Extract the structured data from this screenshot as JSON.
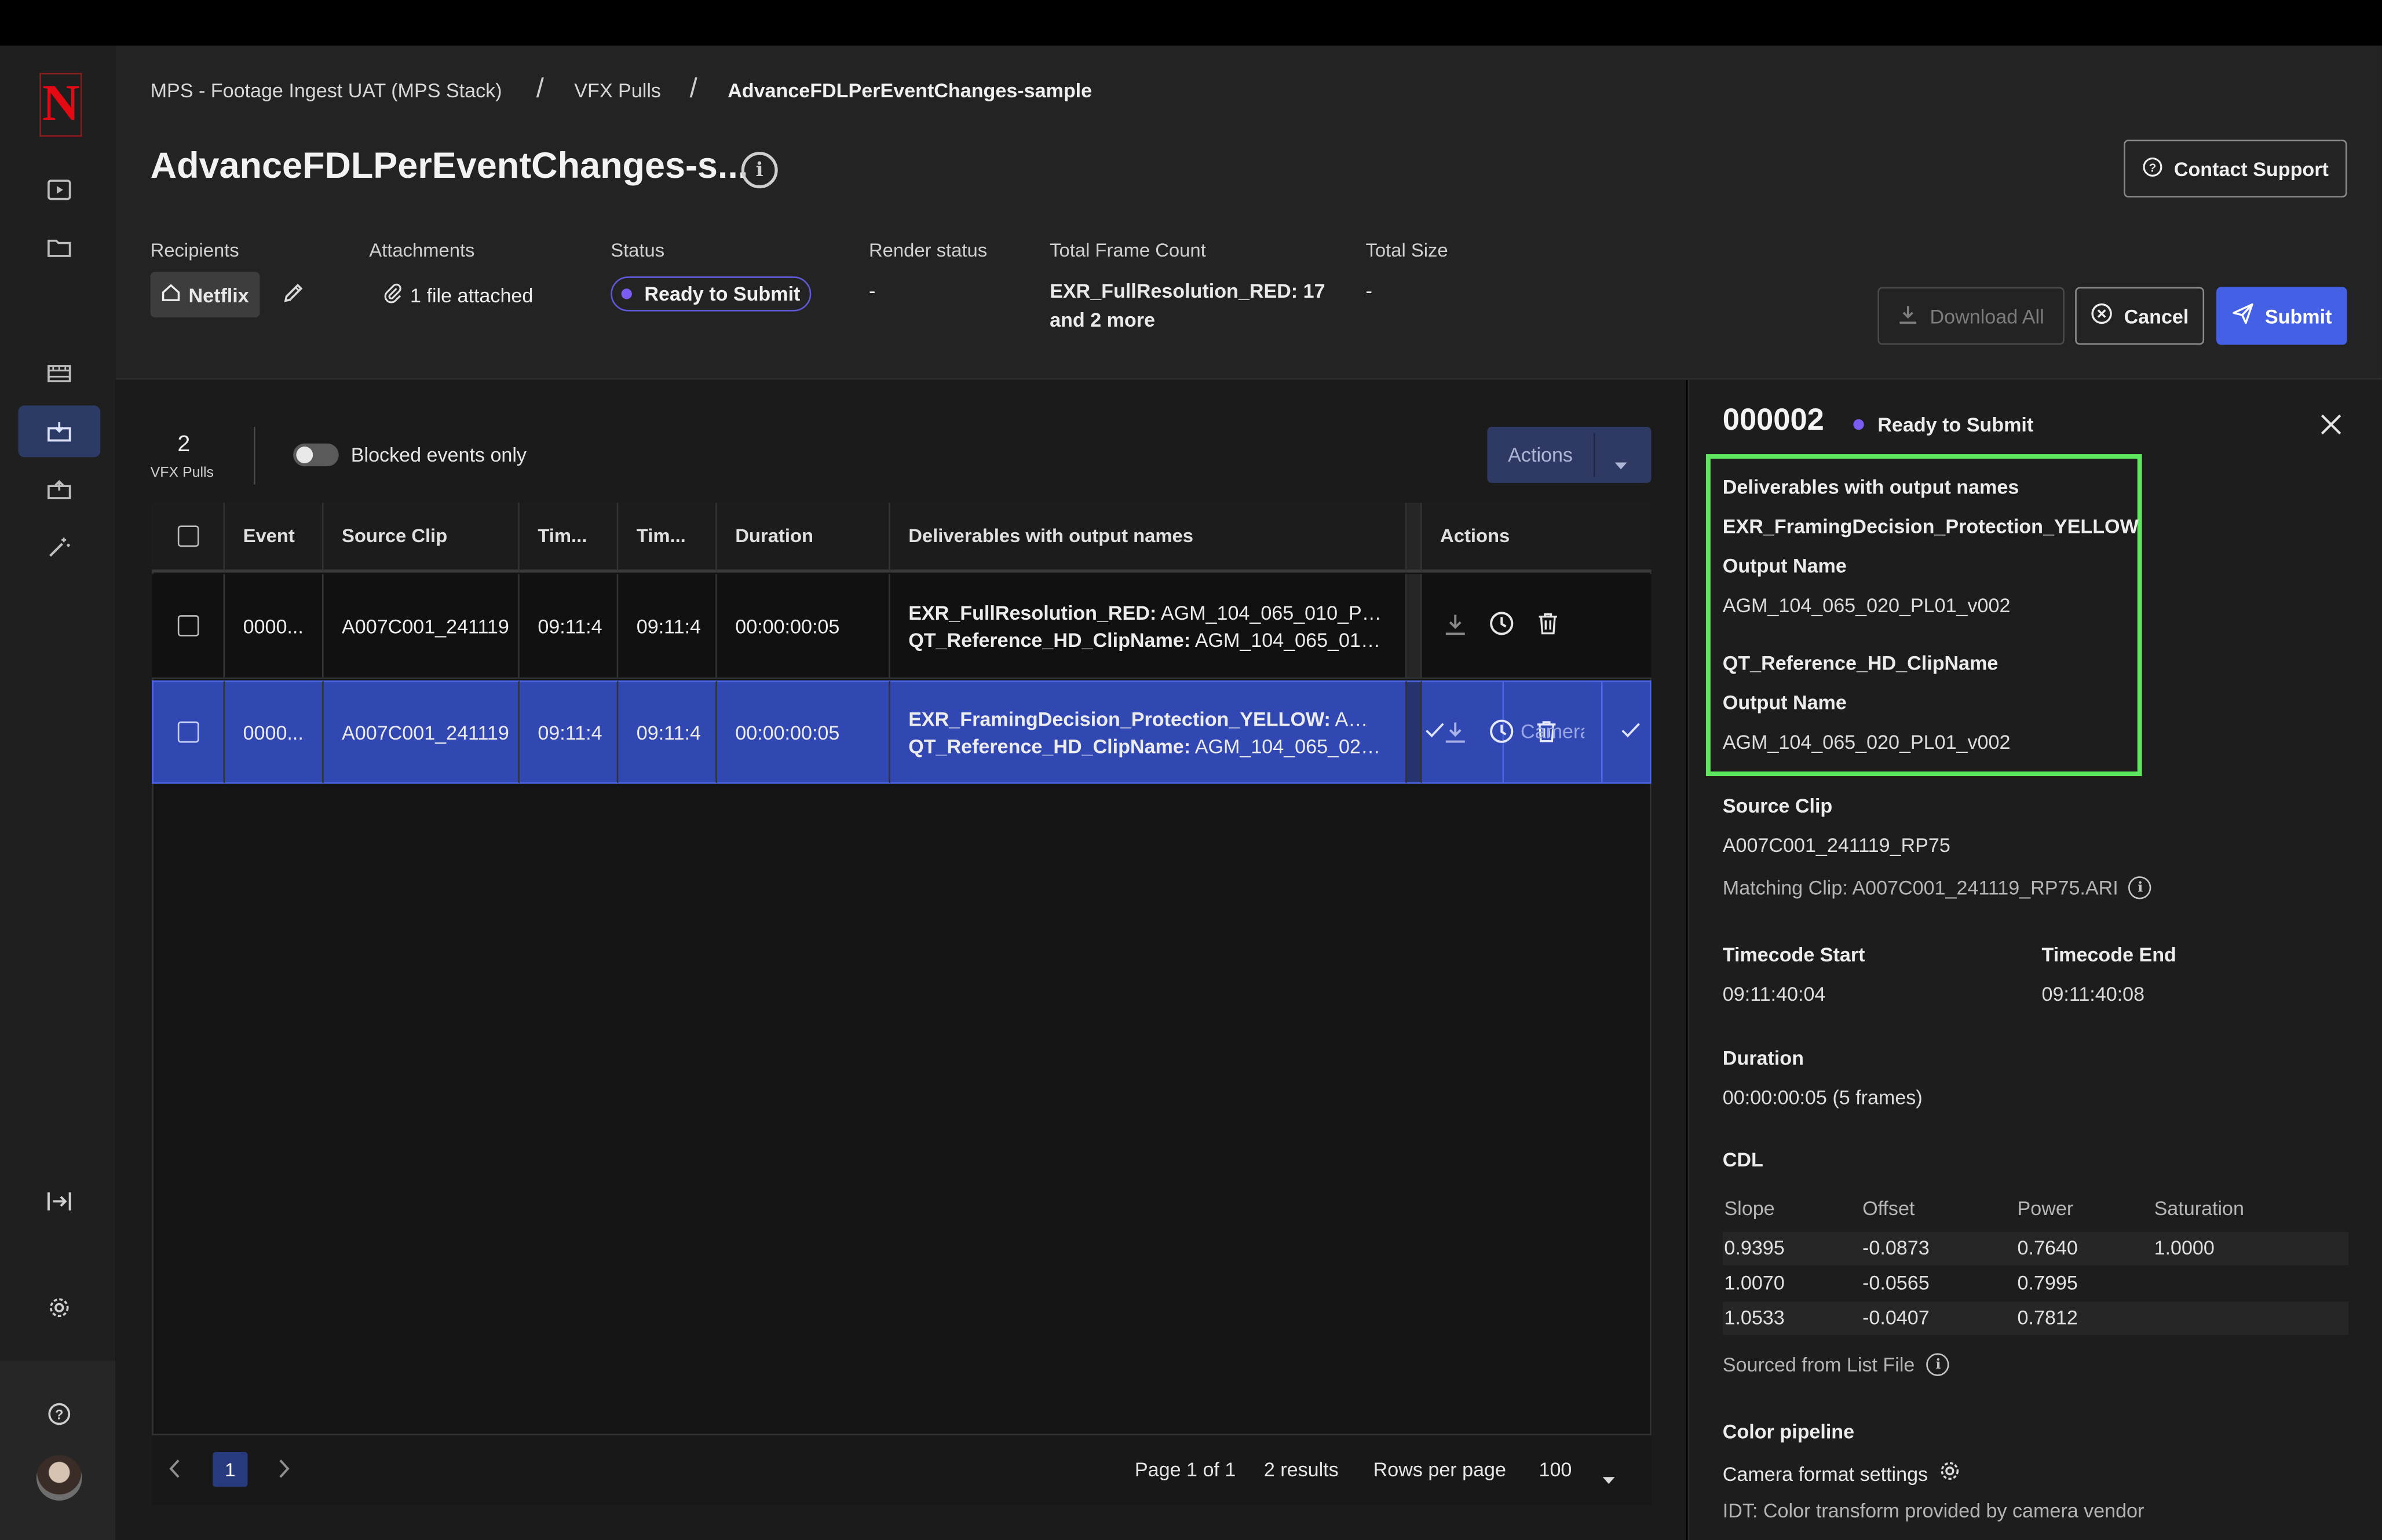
{
  "breadcrumb": [
    "MPS - Footage Ingest UAT (MPS Stack)",
    "VFX Pulls",
    "AdvanceFDLPerEventChanges-sample"
  ],
  "page": {
    "title": "AdvanceFDLPerEventChanges-s...",
    "contact_support": "Contact Support",
    "download_all": "Download All",
    "cancel": "Cancel",
    "submit": "Submit"
  },
  "meta": {
    "recipients_label": "Recipients",
    "recipient": "Netflix",
    "attachments_label": "Attachments",
    "attachments_value": "1 file attached",
    "status_label": "Status",
    "status_value": "Ready to Submit",
    "render_status_label": "Render status",
    "render_status_value": "-",
    "total_frame_label": "Total Frame Count",
    "total_frame_line1": "EXR_FullResolution_RED: 17",
    "total_frame_line2": "and 2 more",
    "total_size_label": "Total Size",
    "total_size_value": "-"
  },
  "toolbar": {
    "count": "2",
    "count_label": "VFX Pulls",
    "blocked_label": "Blocked events only",
    "actions_label": "Actions"
  },
  "table": {
    "columns": [
      "Event",
      "Source Clip",
      "Tim...",
      "Tim...",
      "Duration",
      "Deliverables with output names",
      "Actions"
    ],
    "rows": [
      {
        "event": "0000...",
        "source_clip": "A007C001_241119",
        "tc_start": "09:11:4",
        "tc_end": "09:11:4",
        "duration": "00:00:00:05",
        "deliv1_key": "EXR_FullResolution_RED:",
        "deliv1_val": " AGM_104_065_010_PL01...",
        "deliv2_key": "QT_Reference_HD_ClipName:",
        "deliv2_val": " AGM_104_065_010_..."
      },
      {
        "event": "0000...",
        "source_clip": "A007C001_241119",
        "tc_start": "09:11:4",
        "tc_end": "09:11:4",
        "duration": "00:00:00:05",
        "deliv1_key": "EXR_FramingDecision_Protection_YELLOW:",
        "deliv1_val": " AGM_...",
        "deliv2_key": "QT_Reference_HD_ClipName:",
        "deliv2_val": " AGM_104_065_020_...",
        "overlay_text": "Camera"
      }
    ]
  },
  "pagination": {
    "current_page": "1",
    "page_info": "Page 1 of 1",
    "results": "2 results",
    "rows_per_page_label": "Rows per page",
    "rows_per_page": "100"
  },
  "detail": {
    "id": "000002",
    "status": "Ready to Submit",
    "deliverables_heading": "Deliverables with output names",
    "deliverables": [
      {
        "name": "EXR_FramingDecision_Protection_YELLOW",
        "output_label": "Output Name",
        "output": "AGM_104_065_020_PL01_v002"
      },
      {
        "name": "QT_Reference_HD_ClipName",
        "output_label": "Output Name",
        "output": "AGM_104_065_020_PL01_v002"
      }
    ],
    "source_clip_label": "Source Clip",
    "source_clip": "A007C001_241119_RP75",
    "matching_clip": "Matching Clip: A007C001_241119_RP75.ARI",
    "tc_start_label": "Timecode Start",
    "tc_start": "09:11:40:04",
    "tc_end_label": "Timecode End",
    "tc_end": "09:11:40:08",
    "duration_label": "Duration",
    "duration": "00:00:00:05 (5 frames)",
    "cdl_label": "CDL",
    "cdl_headers": [
      "Slope",
      "Offset",
      "Power",
      "Saturation"
    ],
    "cdl_rows": [
      [
        "0.9395",
        "-0.0873",
        "0.7640",
        "1.0000"
      ],
      [
        "1.0070",
        "-0.0565",
        "0.7995",
        ""
      ],
      [
        "1.0533",
        "-0.0407",
        "0.7812",
        ""
      ]
    ],
    "sourced_from": "Sourced from List File",
    "color_pipeline_label": "Color pipeline",
    "camera_format": "Camera format settings",
    "idt": "IDT: Color transform provided by camera vendor"
  },
  "colors": {
    "primary": "#4461e6",
    "selected_row": "#3147b2",
    "status_dot": "#7a5cf0",
    "highlight_box": "#5ee65e",
    "brand": "#e50914"
  }
}
